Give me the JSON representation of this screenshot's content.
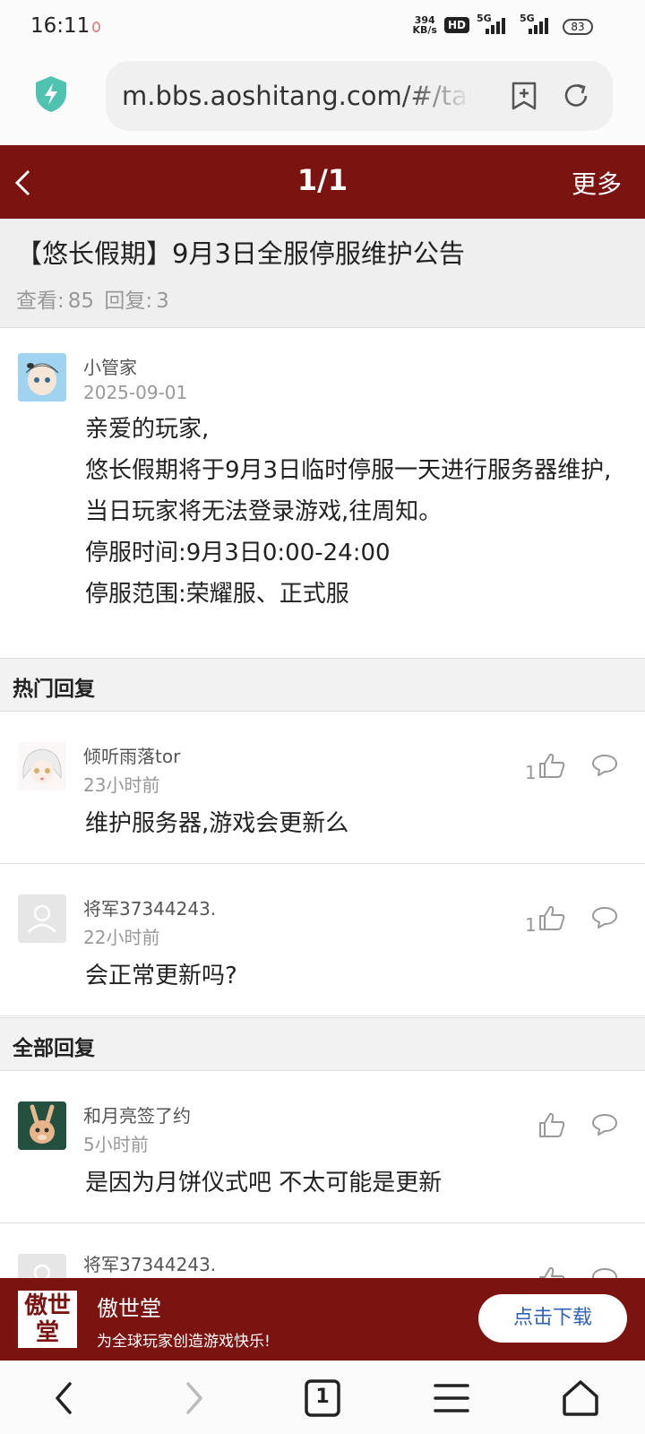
{
  "status_bar": {
    "time": "16:11",
    "net_speed_value": "394",
    "net_speed_unit": "KB/s",
    "hd_badge": "HD",
    "network_1": "5G",
    "network_2": "5G",
    "battery": "83"
  },
  "browser": {
    "url": "m.bbs.aoshitang.com/#/talk"
  },
  "header": {
    "page_indicator": "1/1",
    "more_label": "更多"
  },
  "post": {
    "title": "【悠长假期】9月3日全服停服维护公告",
    "views_label": "查看:",
    "views": "85",
    "replies_label": "回复:",
    "replies": "3",
    "author": "小管家",
    "date": "2025-09-01",
    "body": [
      "亲爱的玩家,",
      "悠长假期将于9月3日临时停服一天进行服务器维护,当日玩家将无法登录游戏,往周知。",
      "停服时间:9月3日0:00-24:00",
      "停服范围:荣耀服、正式服"
    ]
  },
  "hot_replies": {
    "heading": "热门回复",
    "items": [
      {
        "author": "倾听雨落tor",
        "time": "23小时前",
        "content": "维护服务器,游戏会更新么",
        "likes": "1"
      },
      {
        "author": "将军37344243.",
        "time": "22小时前",
        "content": "会正常更新吗?",
        "likes": "1"
      }
    ]
  },
  "all_replies": {
    "heading": "全部回复",
    "items": [
      {
        "author": "和月亮签了约",
        "time": "5小时前",
        "content": "是因为月饼仪式吧 不太可能是更新",
        "likes": ""
      },
      {
        "author": "将军37344243.",
        "time": "",
        "content": "",
        "likes": ""
      }
    ]
  },
  "banner": {
    "logo_text": "傲世堂",
    "name": "傲世堂",
    "slogan": "为全球玩家创造游戏快乐!",
    "download_label": "点击下载"
  },
  "bottom_nav": {
    "tab_count": "1"
  },
  "colors": {
    "header_bg": "#7b1310",
    "download_text": "#2f62b4",
    "shield": "#4fc3b0"
  }
}
